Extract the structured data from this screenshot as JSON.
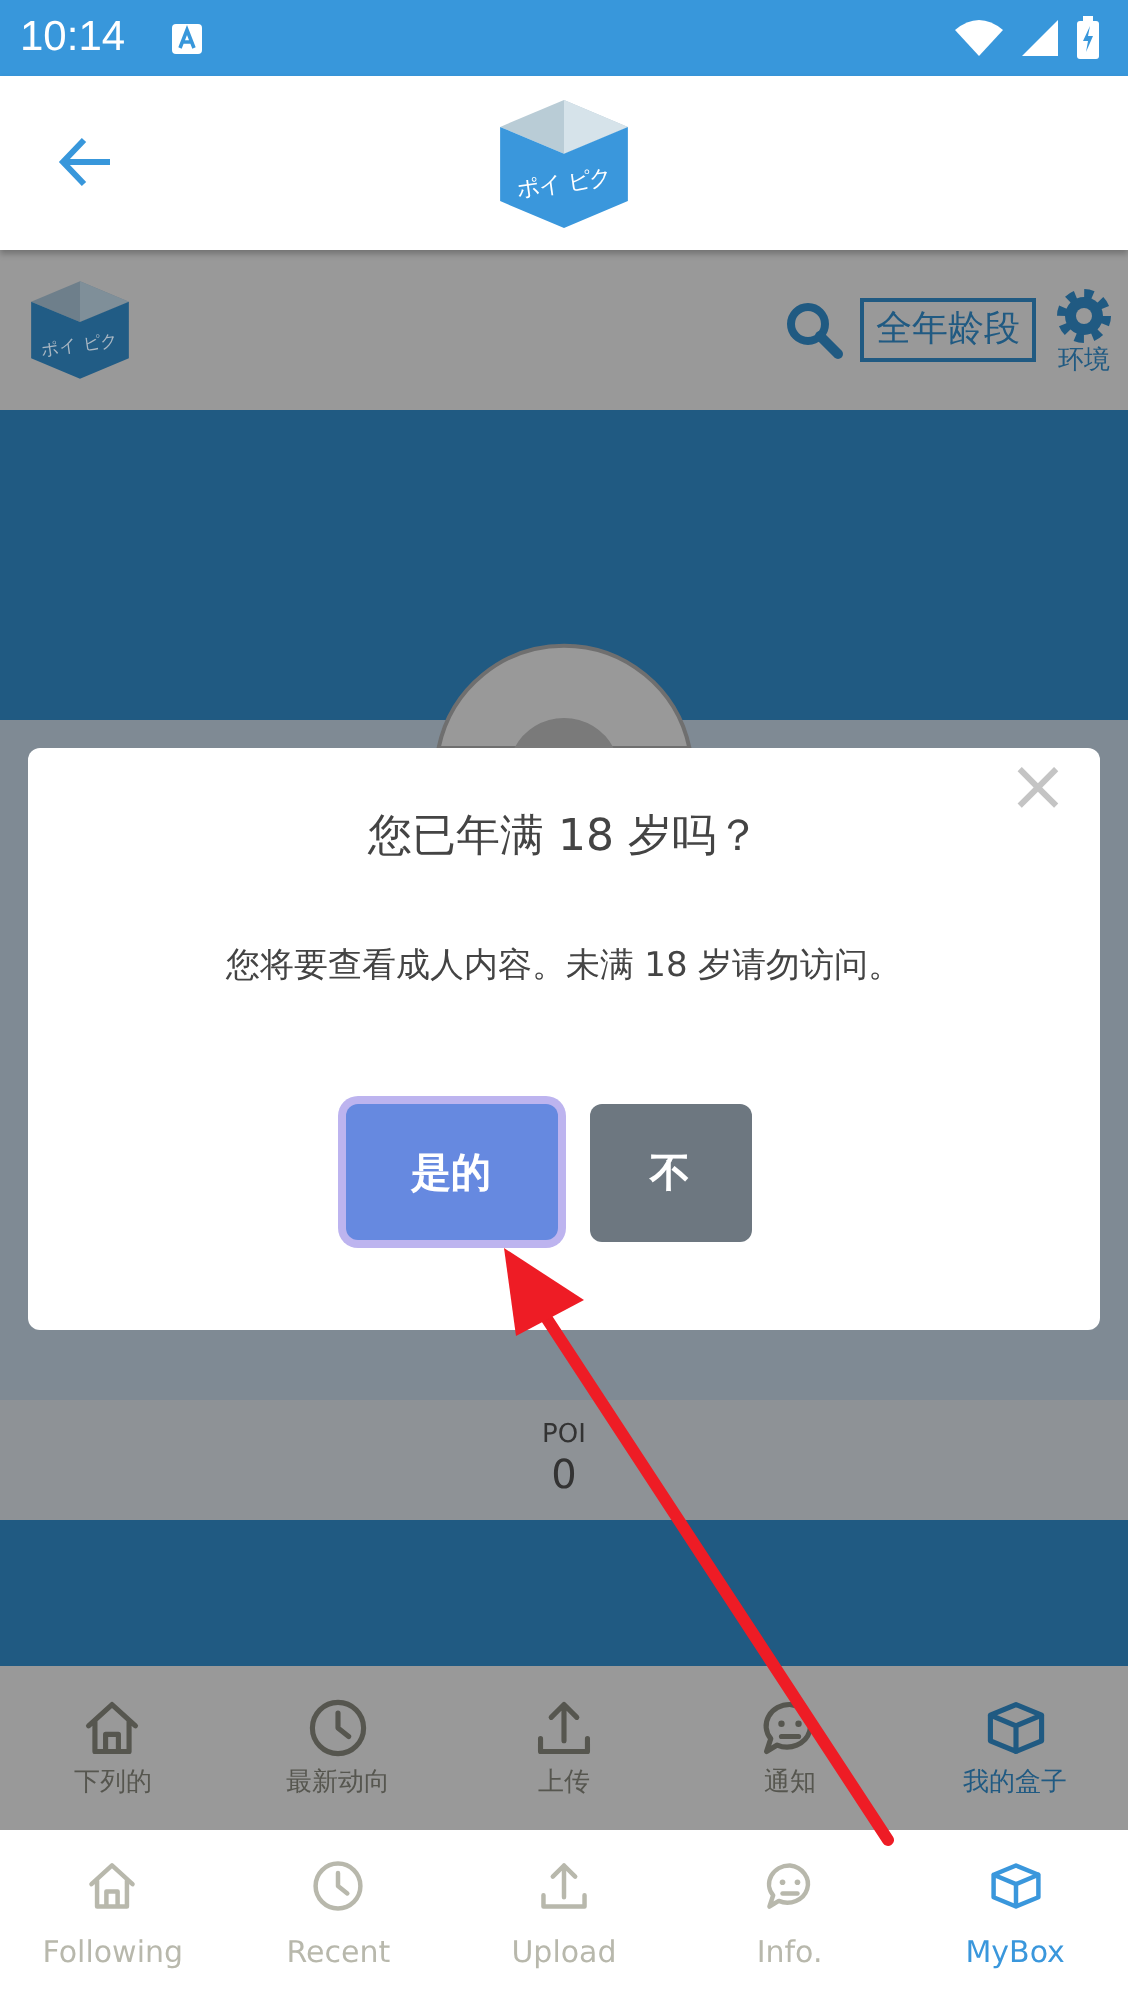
{
  "status_bar": {
    "time": "10:14"
  },
  "app_header": {
    "logo_text": "ポイ ピク"
  },
  "web_header": {
    "logo_text": "ポイ ピク",
    "rating_button": "全年龄段",
    "settings_label": "环境"
  },
  "profile": {
    "stat_label": "POI",
    "stat_value": "0"
  },
  "web_nav": [
    {
      "label": "下列的",
      "kind": "home",
      "selected": false
    },
    {
      "label": "最新动向",
      "kind": "clock",
      "selected": false
    },
    {
      "label": "上传",
      "kind": "upload",
      "selected": false
    },
    {
      "label": "通知",
      "kind": "chat",
      "selected": false
    },
    {
      "label": "我的盒子",
      "kind": "box",
      "selected": true
    }
  ],
  "dialog": {
    "title": "您已年满 18 岁吗？",
    "message": "您将要查看成人内容。未满 18 岁请勿访问。",
    "close": "×",
    "buttons": [
      {
        "label": "是的",
        "kind": "primary",
        "focused": true
      },
      {
        "label": "不",
        "kind": "secondary",
        "focused": false
      }
    ]
  },
  "app_nav": [
    {
      "label": "Following",
      "kind": "home",
      "selected": false
    },
    {
      "label": "Recent",
      "kind": "clock",
      "selected": false
    },
    {
      "label": "Upload",
      "kind": "upload",
      "selected": false
    },
    {
      "label": "Info.",
      "kind": "chat",
      "selected": false
    },
    {
      "label": "MyBox",
      "kind": "box",
      "selected": true
    }
  ]
}
